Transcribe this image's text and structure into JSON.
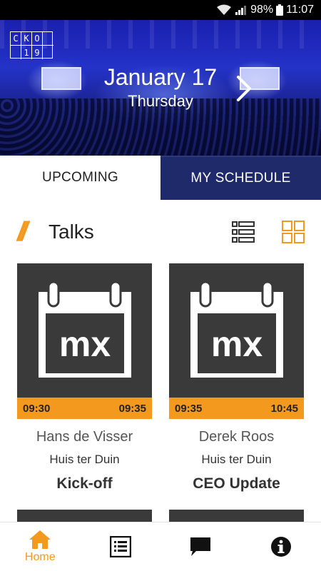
{
  "status_bar": {
    "battery": "98%",
    "time": "11:07"
  },
  "hero": {
    "logo_letters": [
      "C",
      "K",
      "O",
      "",
      "",
      "1",
      "9",
      ""
    ],
    "date": "January 17",
    "weekday": "Thursday"
  },
  "tabs": [
    {
      "label": "UPCOMING",
      "active": true
    },
    {
      "label": "MY SCHEDULE",
      "active": false
    }
  ],
  "section": {
    "title": "Talks"
  },
  "talks": [
    {
      "start": "09:30",
      "end": "09:35",
      "speaker": "Hans de Visser",
      "room": "Huis ter Duin",
      "title": "Kick-off",
      "logo_text": "mx"
    },
    {
      "start": "09:35",
      "end": "10:45",
      "speaker": "Derek Roos",
      "room": "Huis ter Duin",
      "title": "CEO Update",
      "logo_text": "mx"
    }
  ],
  "bottom_nav": [
    {
      "label": "Home",
      "icon": "home-icon",
      "active": true
    },
    {
      "label": "",
      "icon": "list-icon",
      "active": false
    },
    {
      "label": "",
      "icon": "chat-icon",
      "active": false
    },
    {
      "label": "",
      "icon": "info-icon",
      "active": false
    }
  ],
  "colors": {
    "accent": "#f39a1e",
    "tab_dark": "#1f2a6b",
    "card_bg": "#3a3a3a"
  }
}
